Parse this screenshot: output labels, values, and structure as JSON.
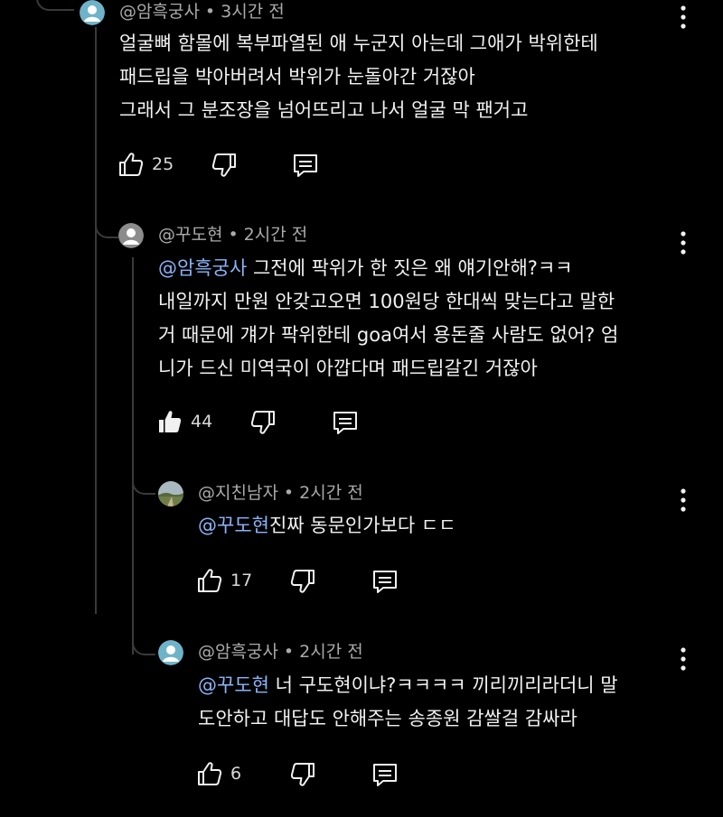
{
  "comments": [
    {
      "author": "@암흑궁사",
      "time": "3시간 전",
      "lines": [
        "얼굴뼈 함몰에 복부파열된 애 누군지 아는데 그애가 박위한테",
        "패드립을 박아버려서 박위가 눈돌아간 거잖아",
        "그래서 그 분조장을 넘어뜨리고 나서 얼굴 막 팬거고"
      ],
      "likes": "25",
      "liked": false
    },
    {
      "author": "@꾸도현",
      "time": "2시간 전",
      "mention": "@암흑궁사",
      "lines": [
        " 그전에 팍위가 한 짓은 왜 얘기안해?ㅋㅋ",
        "내일까지 만원 안갖고오면 100원당 한대씩 맞는다고 말한",
        "거 때문에 걔가 팍위한테 goa여서 용돈줄 사람도 없어? 엄",
        "니가 드신 미역국이 아깝다며 패드립갈긴 거잖아"
      ],
      "likes": "44",
      "liked": true
    },
    {
      "author": "@지친남자",
      "time": "2시간 전",
      "mention": "@꾸도현",
      "lines": [
        "진짜 동문인가보다 ㄷㄷ"
      ],
      "likes": "17",
      "liked": false
    },
    {
      "author": "@암흑궁사",
      "time": "2시간 전",
      "mention": "@꾸도현",
      "lines": [
        " 너 구도현이냐?ㅋㅋㅋㅋ 끼리끼리라더니 말",
        "도안하고 대답도 안해주는 송종원 감쌀걸 감싸라"
      ],
      "likes": "6",
      "liked": false
    }
  ],
  "icons": {
    "like": "thumbs-up-icon",
    "dislike": "thumbs-down-icon",
    "reply": "reply-icon",
    "more": "more-vert-icon"
  },
  "colors": {
    "background": "#000000",
    "text": "#f1f1f1",
    "meta": "#aaaaaa",
    "mention": "#8ab4f8",
    "thread": "#3a3a3a"
  }
}
